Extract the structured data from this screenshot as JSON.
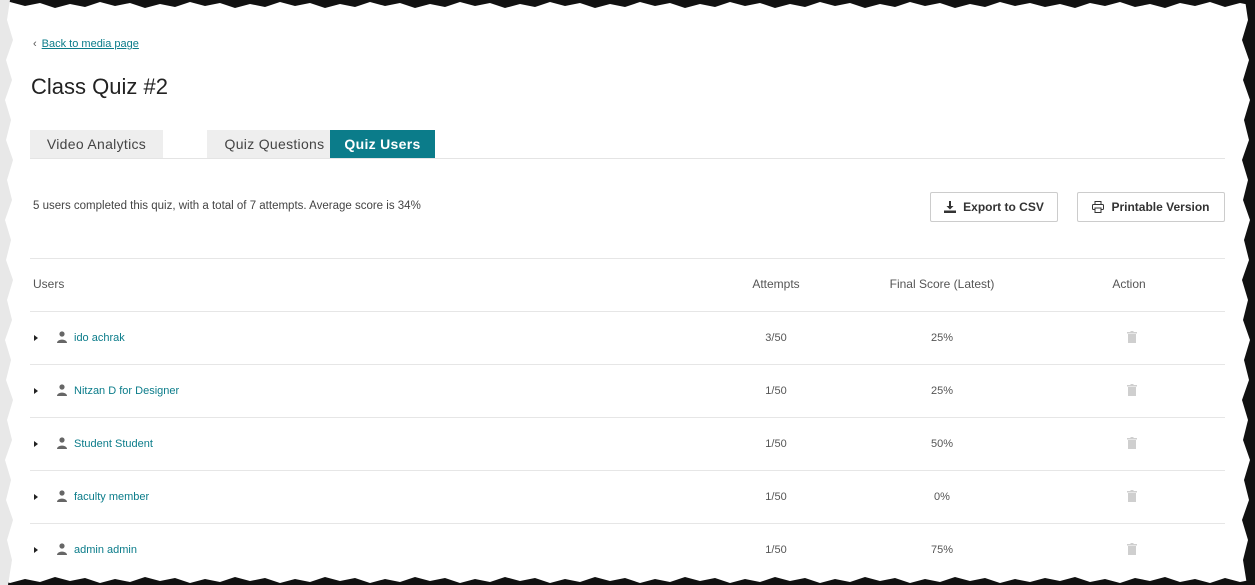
{
  "nav": {
    "back_label": "Back to media page"
  },
  "page": {
    "title": "Class Quiz #2"
  },
  "tabs": [
    {
      "label": "Video Analytics",
      "active": false
    },
    {
      "label": "Quiz Questions",
      "active": false
    },
    {
      "label": "Quiz Users",
      "active": true
    }
  ],
  "summary": {
    "text": "5 users completed this quiz, with a total of 7 attempts. Average score is 34%"
  },
  "actions": {
    "export_label": "Export to CSV",
    "print_label": "Printable Version"
  },
  "table": {
    "headers": {
      "users": "Users",
      "attempts": "Attempts",
      "score": "Final Score (Latest)",
      "action": "Action"
    },
    "rows": [
      {
        "name": "ido achrak",
        "attempts": "3/50",
        "score": "25%"
      },
      {
        "name": "Nitzan D for Designer",
        "attempts": "1/50",
        "score": "25%"
      },
      {
        "name": "Student Student",
        "attempts": "1/50",
        "score": "50%"
      },
      {
        "name": "faculty member",
        "attempts": "1/50",
        "score": "0%"
      },
      {
        "name": "admin admin",
        "attempts": "1/50",
        "score": "75%"
      }
    ]
  },
  "colors": {
    "accent": "#0b7c8a",
    "tab_inactive": "#eeeeee",
    "border": "#e6e6e6"
  }
}
